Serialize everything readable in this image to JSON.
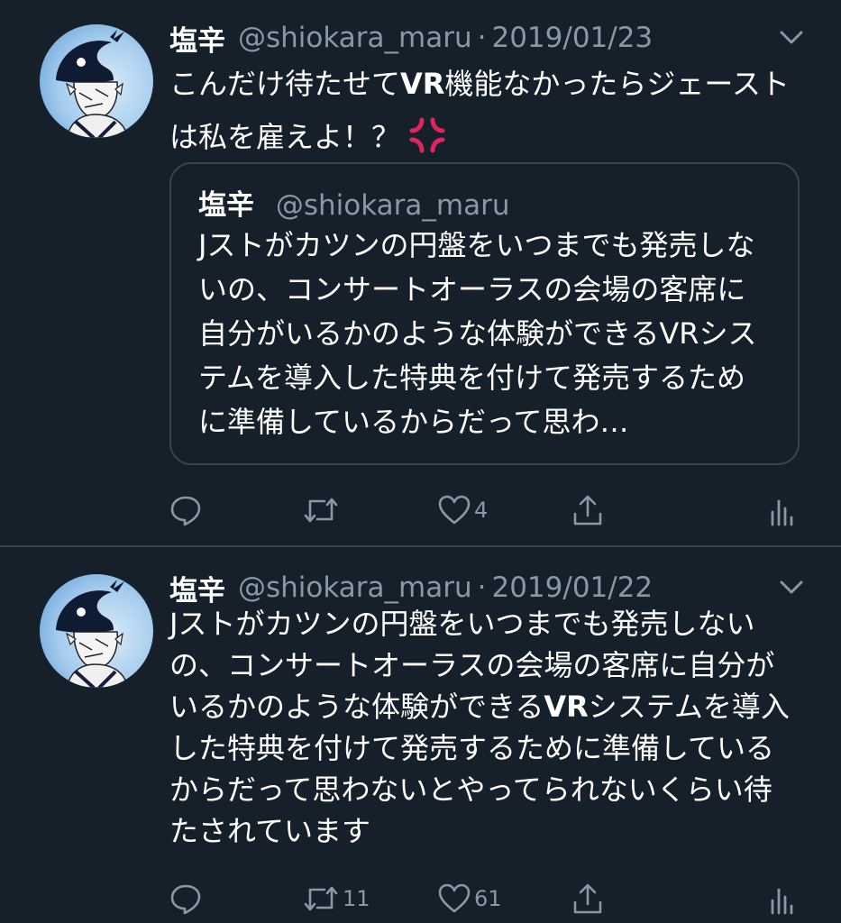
{
  "tweets": [
    {
      "name": "塩辛",
      "handle": "@shiokara_maru",
      "separator": "·",
      "date": "2019/01/23",
      "text": [
        {
          "t": "こんだけ待たせて",
          "b": false
        },
        {
          "t": "VR",
          "b": true
        },
        {
          "t": "機能なかったらジェーストは私を雇えよ！？",
          "b": false
        }
      ],
      "emoji": "anger-symbol",
      "quote": {
        "name": "塩辛",
        "handle": "@shiokara_maru",
        "text": "Jストがカツンの円盤をいつまでも発売しないの、コンサートオーラスの会場の客席に自分がいるかのような体験ができるVRシステムを導入した特典を付けて発売するために準備しているからだって思わ…"
      },
      "actions": {
        "reply": "",
        "retweet": "",
        "like": "4"
      }
    },
    {
      "name": "塩辛",
      "handle": "@shiokara_maru",
      "separator": "·",
      "date": "2019/01/22",
      "text": [
        {
          "t": "Jストがカツンの円盤をいつまでも発売しないの、コンサートオーラスの会場の客席に自分がいるかのような体験ができる",
          "b": false
        },
        {
          "t": "VR",
          "b": true
        },
        {
          "t": "システムを導入した特典を付けて発売するために準備しているからだって思わないとやってられないくらい待たされています",
          "b": false
        }
      ],
      "actions": {
        "reply": "",
        "retweet": "11",
        "like": "61"
      }
    }
  ],
  "colors": {
    "background": "#15202b",
    "text": "#ffffff",
    "secondary": "#8899a6",
    "border": "#38444d",
    "anger": "#e0245e"
  },
  "icons": [
    "chevron-down-icon",
    "reply-icon",
    "retweet-icon",
    "like-icon",
    "share-icon",
    "analytics-icon"
  ]
}
